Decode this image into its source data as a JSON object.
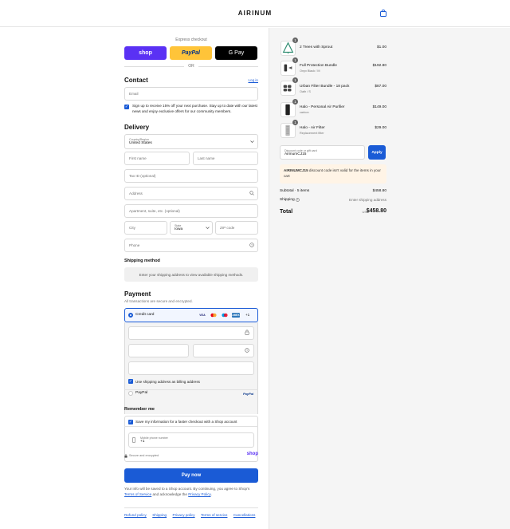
{
  "header": {
    "logo": "AIRINUM"
  },
  "express": {
    "label": "Express checkout",
    "shop": "shop",
    "paypal": "PayPal",
    "gpay": "G Pay",
    "or": "OR"
  },
  "contact": {
    "title": "Contact",
    "login": "Log in",
    "email_placeholder": "Email",
    "newsletter_text": "Sign up to receive 15% off your next purchase. Stay up to date with our latest news and enjoy exclusive offers for our community members."
  },
  "delivery": {
    "title": "Delivery",
    "country_label": "Country/Region",
    "country_value": "United States",
    "first_name": "First name",
    "last_name": "Last name",
    "tax_id": "Tax ID (optional)",
    "address": "Address",
    "apartment": "Apartment, suite, etc. (optional)",
    "city": "City",
    "state_label": "State",
    "state_value": "Iowa",
    "zip": "ZIP code",
    "phone": "Phone"
  },
  "shipping_method": {
    "title": "Shipping method",
    "notice": "Enter your shipping address to view available shipping methods."
  },
  "payment": {
    "title": "Payment",
    "subtitle": "All transactions are secure and encrypted.",
    "credit_card": "Credit card",
    "card_icons": [
      "VISA",
      "MC",
      "MAE",
      "AMEX"
    ],
    "more_cards": "+1",
    "billing_text": "Use shipping address as billing address",
    "paypal": "PayPal",
    "paypal_logo": "PayPal"
  },
  "remember": {
    "title": "Remember me",
    "save_text": "Save my information for a faster checkout with a Shop account",
    "mobile_label": "Mobile phone number",
    "mobile_value": "+1",
    "secure_text": "Secure and encrypted",
    "shop_logo": "shop"
  },
  "pay_now": "Pay now",
  "legal": {
    "text1": "Your info will be saved to a Shop account. By continuing, you agree to Shop's",
    "terms": "Terms of Service",
    "and": "and acknowledge the",
    "privacy": "Privacy Policy",
    "end": "."
  },
  "footer_links": [
    "Refund policy",
    "Shipping",
    "Privacy policy",
    "Terms of service",
    "Cancellations"
  ],
  "cart": {
    "items": [
      {
        "qty": "1",
        "name": "2 Trees with Sprout",
        "variant": "",
        "price": "$1.00"
      },
      {
        "qty": "1",
        "name": "Full Protection Bundle",
        "variant": "Onyx Black / M",
        "price": "$192.80"
      },
      {
        "qty": "1",
        "name": "Urban Filter Bundle - 18 pack",
        "variant": "Oath / S",
        "price": "$87.00"
      },
      {
        "qty": "1",
        "name": "Halo - Personal Air Purifier",
        "variant": "carbon",
        "price": "$149.00"
      },
      {
        "qty": "1",
        "name": "Halo - Air Filter",
        "variant": "Replacement filter",
        "price": "$29.00"
      }
    ],
    "discount_label": "Discount code or gift card",
    "discount_value": "AirinumCJ15",
    "apply": "Apply",
    "error_code": "AIRINUMCJ15",
    "error_text": " discount code isn't valid for the items in your cart",
    "subtotal_label": "Subtotal · 5 items",
    "subtotal_value": "$458.80",
    "shipping_label": "Shipping",
    "shipping_value": "Enter shipping address",
    "total_label": "Total",
    "total_currency": "USD",
    "total_value": "$458.80"
  },
  "colors": {
    "accent": "#1a5bd6",
    "shop_purple": "#5a31f4",
    "paypal_yellow": "#ffc439"
  }
}
